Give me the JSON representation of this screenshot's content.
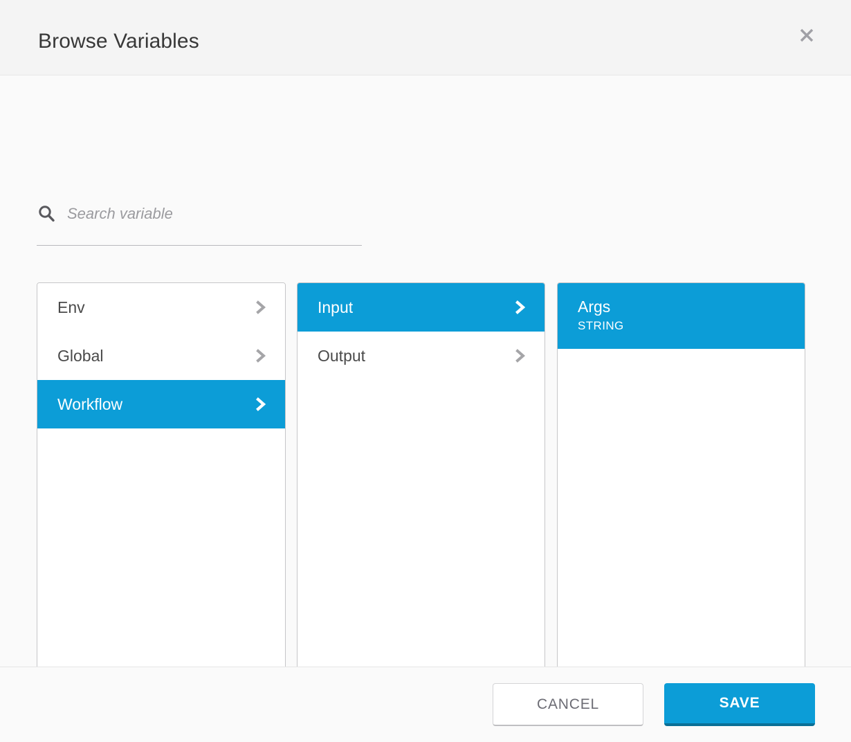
{
  "header": {
    "title": "Browse Variables",
    "close_icon": "close-icon"
  },
  "search": {
    "icon": "search-icon",
    "placeholder": "Search variable",
    "value": ""
  },
  "columns": [
    {
      "name": "scope-column",
      "items": [
        {
          "label": "Env",
          "type": "",
          "selected": false,
          "chevron": "chevron-right-icon"
        },
        {
          "label": "Global",
          "type": "",
          "selected": false,
          "chevron": "chevron-right-icon"
        },
        {
          "label": "Workflow",
          "type": "",
          "selected": true,
          "chevron": "chevron-right-icon"
        }
      ]
    },
    {
      "name": "direction-column",
      "items": [
        {
          "label": "Input",
          "type": "",
          "selected": true,
          "chevron": "chevron-right-icon"
        },
        {
          "label": "Output",
          "type": "",
          "selected": false,
          "chevron": "chevron-right-icon"
        }
      ]
    },
    {
      "name": "variable-column",
      "items": [
        {
          "label": "Args",
          "type": "STRING",
          "selected": true,
          "chevron": ""
        }
      ]
    }
  ],
  "footer": {
    "cancel_label": "CANCEL",
    "save_label": "SAVE"
  },
  "colors": {
    "accent": "#0c9dd7",
    "accent_dark": "#0a6f96",
    "header_bg": "#f4f4f4",
    "body_bg": "#fafafa",
    "panel_border": "#c6c6c8",
    "text": "#4a4a4a",
    "muted": "#9b9b9f"
  }
}
